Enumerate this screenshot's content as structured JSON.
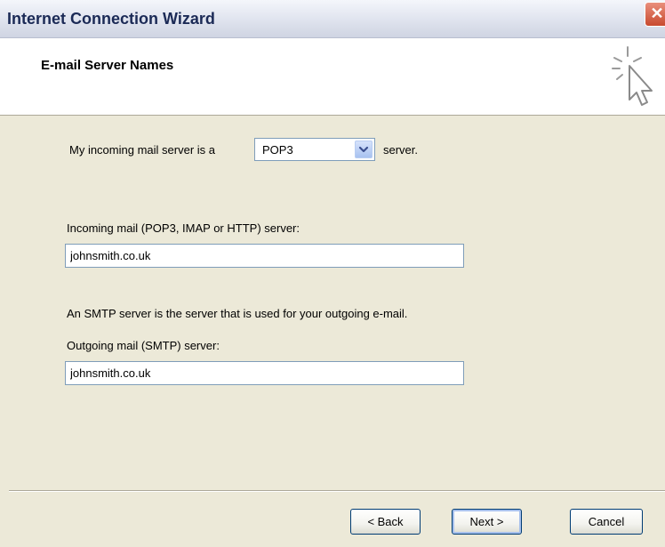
{
  "window": {
    "title": "Internet Connection Wizard",
    "close_glyph": "✕"
  },
  "header": {
    "title": "E-mail Server Names",
    "icon": "cursor-sparkle-icon"
  },
  "form": {
    "incoming_prefix": "My incoming mail server is a",
    "server_type": "POP3",
    "incoming_suffix": "server.",
    "incoming_label": "Incoming mail (POP3, IMAP or HTTP) server:",
    "incoming_value": "johnsmith.co.uk",
    "smtp_description": "An SMTP server is the server that is used for your outgoing e-mail.",
    "outgoing_label": "Outgoing mail (SMTP) server:",
    "outgoing_value": "johnsmith.co.uk"
  },
  "buttons": {
    "back": "< Back",
    "next": "Next >",
    "cancel": "Cancel"
  }
}
